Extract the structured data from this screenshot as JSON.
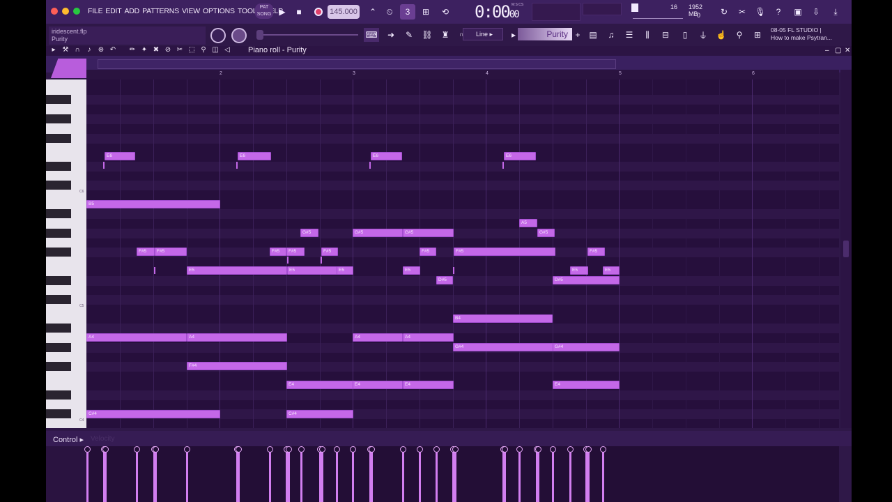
{
  "menu": [
    "FILE",
    "EDIT",
    "ADD",
    "PATTERNS",
    "VIEW",
    "OPTIONS",
    "TOOLS",
    "HELP"
  ],
  "transport": {
    "pat_label": "PAT",
    "song_label": "SONG",
    "tempo": "145.000",
    "time": "0:00",
    "time_sub": "00",
    "time_unit": "M:S:CS"
  },
  "cpu": {
    "voices": "16",
    "memory": "1952 MB",
    "polyphony": "0"
  },
  "file": {
    "name": "iridescent.flp",
    "pattern": "Purity"
  },
  "snap": "Line",
  "pattern_selector": "Purity",
  "news": {
    "line1": "08-05  FL STUDIO |",
    "line2": "How to make Psytran..."
  },
  "piano_roll": {
    "title": "Piano roll - Purity"
  },
  "ruler": [
    "2",
    "3",
    "4",
    "5",
    "6"
  ],
  "key_labels": [
    "C6",
    "C5",
    "C4"
  ],
  "control": {
    "label": "Control",
    "target": "Velocity"
  },
  "notes_text": {
    "e6a": "E6",
    "e6b": "E6",
    "e6c": "E6",
    "e6d": "E6",
    "b5": "B5",
    "a5": "A5",
    "gs5a": "G#5",
    "gs5b": "G#5",
    "gs5c": "G#5",
    "gs5d": "G#5",
    "fs5a": "F#5",
    "fs5b": "F#5",
    "fs5c": "F#5",
    "fs5d": "F#5",
    "fs5e": "F#5",
    "fs5f": "F#5",
    "fs5g": "F#5",
    "fs5h": "F#5",
    "e5a": "E5",
    "e5b": "E5",
    "e5c": "E5",
    "e5d": "E5",
    "e5e": "E5",
    "e5f": "E5",
    "ds5a": "D#5",
    "ds5b": "D#5",
    "b4": "B4",
    "a4a": "A4",
    "a4b": "A4",
    "a4c": "A4",
    "a4d": "A4",
    "gs4a": "G#4",
    "gs4b": "G#4",
    "fs4": "F#4",
    "e4a": "E4",
    "e4b": "E4",
    "e4c": "E4",
    "e4d": "E4",
    "cs4a": "C#4",
    "cs4b": "C#4"
  }
}
